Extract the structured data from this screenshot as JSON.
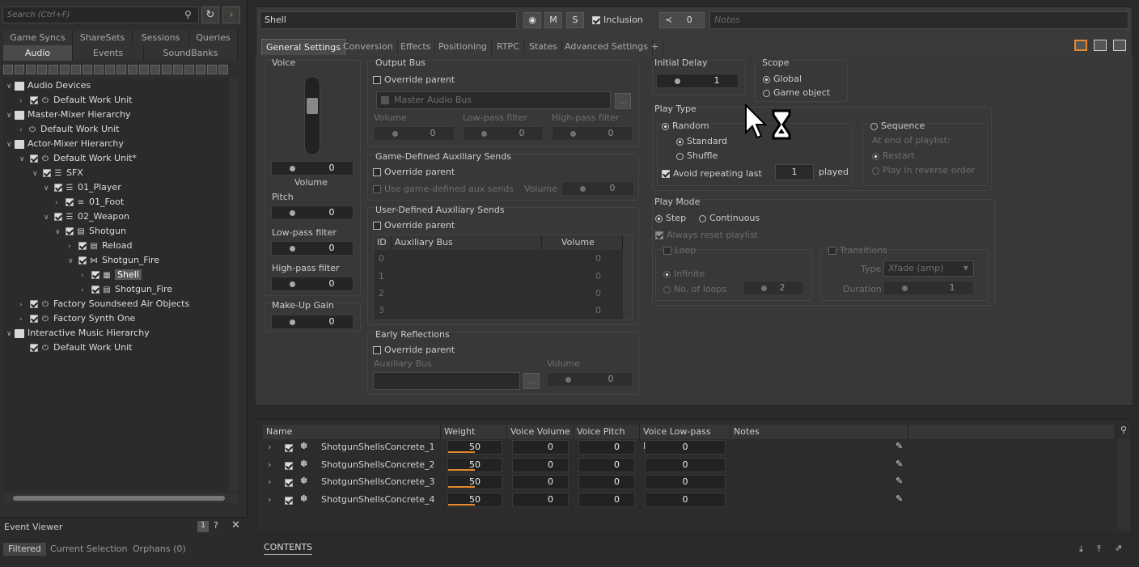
{
  "search": {
    "placeholder": "Search (Ctrl+F)"
  },
  "left_tabs_row1": [
    "Game Syncs",
    "ShareSets",
    "Sessions",
    "Queries"
  ],
  "left_tabs_row2": [
    "Audio",
    "Events",
    "SoundBanks"
  ],
  "tree": [
    {
      "label": "Audio Devices"
    },
    {
      "label": "Default Work Unit"
    },
    {
      "label": "Master-Mixer Hierarchy"
    },
    {
      "label": "Default Work Unit"
    },
    {
      "label": "Actor-Mixer Hierarchy"
    },
    {
      "label": "Default Work Unit*"
    },
    {
      "label": "SFX"
    },
    {
      "label": "01_Player"
    },
    {
      "label": "01_Foot"
    },
    {
      "label": "02_Weapon"
    },
    {
      "label": "Shotgun"
    },
    {
      "label": "Reload"
    },
    {
      "label": "Shotgun_Fire"
    },
    {
      "label": "Shell"
    },
    {
      "label": "Shotgun_Fire"
    },
    {
      "label": "Factory Soundseed Air Objects"
    },
    {
      "label": "Factory Synth One"
    },
    {
      "label": "Interactive Music Hierarchy"
    },
    {
      "label": "Default Work Unit"
    }
  ],
  "event_viewer": {
    "title": "Event Viewer",
    "tabs": [
      "Filtered",
      "Current Selection",
      "Orphans (0)"
    ],
    "badge": "1"
  },
  "header": {
    "name": "Shell",
    "m": "M",
    "s": "S",
    "inclusion": "Inclusion",
    "share_count": "0",
    "notes_placeholder": "Notes"
  },
  "prop_tabs": [
    "General Settings",
    "Conversion",
    "Effects",
    "Positioning",
    "RTPC",
    "States",
    "Advanced Settings",
    "+"
  ],
  "voice": {
    "title": "Voice",
    "volume_label": "Volume",
    "volume": "0",
    "pitch_label": "Pitch",
    "pitch": "0",
    "lpf_label": "Low-pass filter",
    "lpf": "0",
    "hpf_label": "High-pass filter",
    "hpf": "0",
    "makeup_title": "Make-Up Gain",
    "makeup": "0"
  },
  "output_bus": {
    "title": "Output Bus",
    "override": "Override parent",
    "bus": "Master Audio Bus",
    "vol_label": "Volume",
    "vol": "0",
    "lpf_label": "Low-pass filter",
    "lpf": "0",
    "hpf_label": "High-pass filter",
    "hpf": "0"
  },
  "game_aux": {
    "title": "Game-Defined Auxiliary Sends",
    "override": "Override parent",
    "use": "Use game-defined aux sends",
    "vol_label": "Volume",
    "vol": "0"
  },
  "user_aux": {
    "title": "User-Defined Auxiliary Sends",
    "override": "Override parent",
    "cols": [
      "ID",
      "Auxiliary Bus",
      "Volume"
    ],
    "rows": [
      {
        "id": "0",
        "vol": "0"
      },
      {
        "id": "1",
        "vol": "0"
      },
      {
        "id": "2",
        "vol": "0"
      },
      {
        "id": "3",
        "vol": "0"
      }
    ]
  },
  "early": {
    "title": "Early Reflections",
    "override": "Override parent",
    "aux_label": "Auxiliary Bus",
    "vol_label": "Volume",
    "vol": "0"
  },
  "initial_delay": {
    "title": "Initial Delay",
    "value": "1"
  },
  "scope": {
    "title": "Scope",
    "global": "Global",
    "game_object": "Game object"
  },
  "play_type": {
    "title": "Play Type",
    "random": "Random",
    "standard": "Standard",
    "shuffle": "Shuffle",
    "avoid": "Avoid repeating last",
    "avoid_val": "1",
    "played": "played",
    "sequence": "Sequence",
    "end_label": "At end of playlist:",
    "restart": "Restart",
    "reverse": "Play in reverse order"
  },
  "play_mode": {
    "title": "Play Mode",
    "step": "Step",
    "continuous": "Continuous",
    "always_reset": "Always reset playlist",
    "loop": "Loop",
    "infinite": "Infinite",
    "no_loops": "No. of loops",
    "loops_val": "2",
    "transitions": "Transitions",
    "type_label": "Type",
    "type_val": "Xfade (amp)",
    "duration_label": "Duration",
    "duration_val": "1"
  },
  "list": {
    "cols": [
      "Name",
      "Weight",
      "Voice Volume",
      "Voice Pitch",
      "Voice Low-pass Filter",
      "Notes"
    ],
    "rows": [
      {
        "name": "ShotgunShellsConcrete_1",
        "weight": "50",
        "vv": "0",
        "vp": "0",
        "vl": "0",
        "weight_fraction": 0.5
      },
      {
        "name": "ShotgunShellsConcrete_2",
        "weight": "50",
        "vv": "0",
        "vp": "0",
        "vl": "0",
        "weight_fraction": 0.5
      },
      {
        "name": "ShotgunShellsConcrete_3",
        "weight": "50",
        "vv": "0",
        "vp": "0",
        "vl": "0",
        "weight_fraction": 0.5
      },
      {
        "name": "ShotgunShellsConcrete_4",
        "weight": "50",
        "vv": "0",
        "vp": "0",
        "vl": "0",
        "weight_fraction": 0.5
      }
    ]
  },
  "contents_label": "CONTENTS",
  "colors": {
    "accent": "#e68a2e",
    "panel": "#383838",
    "bg": "#2a2a2a"
  }
}
